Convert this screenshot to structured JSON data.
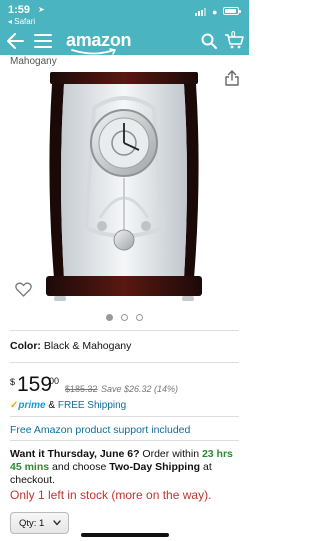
{
  "status_bar": {
    "time": "1:59",
    "back_app": "◂ Safari"
  },
  "nav": {
    "logo": "amazon",
    "cart_count": "0",
    "icons": [
      "back-arrow-icon",
      "hamburger-menu-icon",
      "search-icon",
      "cart-icon"
    ]
  },
  "product": {
    "brand_line": "Mahogany",
    "image_count": 3,
    "active_image": 1,
    "color_label": "Color:",
    "color_value": "Black & Mahogany",
    "price_symbol": "$",
    "price_whole": "159",
    "price_fraction": "00",
    "list_price": "$185.32",
    "savings": "Save $26.32 (14%)",
    "prime_check": "✓",
    "prime_label": "prime",
    "prime_amp": "&",
    "free_shipping": "FREE Shipping",
    "support_link": "Free Amazon product support included"
  },
  "delivery": {
    "want_it": "Want it Thursday, June 6?",
    "order_within": " Order within ",
    "countdown": "23 hrs 45 mins",
    "choose": " and choose ",
    "shipping_option": "Two-Day Shipping",
    "at_checkout": " at checkout."
  },
  "stock": {
    "message": "Only 1 left in stock (more on the way)."
  },
  "quantity": {
    "label": "Qty: 1"
  },
  "colors": {
    "header_bg": "#4bb4c1",
    "link": "#0f6e9b",
    "stock_red": "#c3342f",
    "countdown_green": "#2a8a33",
    "prime_blue": "#1a98d3",
    "prime_orange": "#f0a31a"
  }
}
